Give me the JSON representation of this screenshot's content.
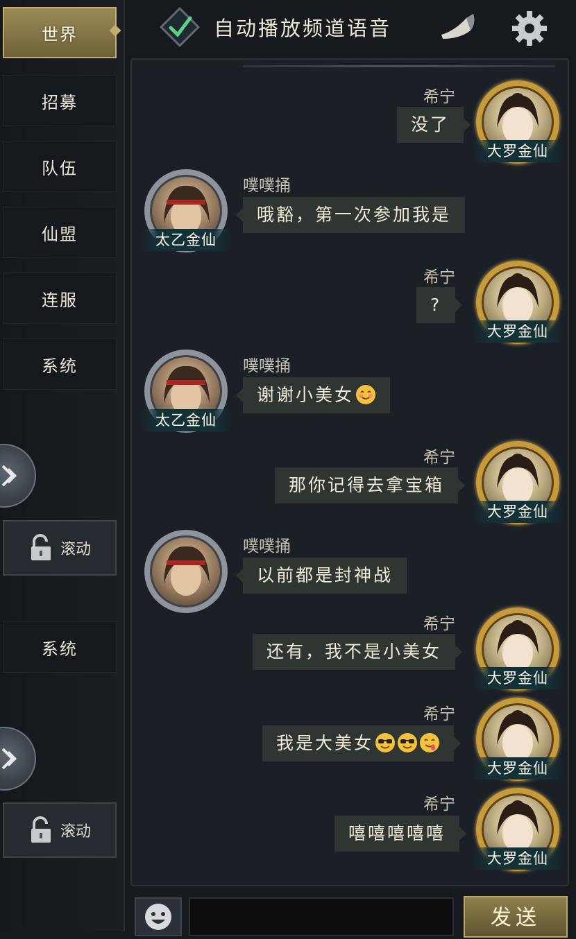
{
  "sidebar": {
    "tabs": [
      "世界",
      "招募",
      "队伍",
      "仙盟",
      "连服",
      "系统"
    ],
    "active_tab": "世界",
    "scroll_label": "滚动",
    "secondary_tab": "系统",
    "scroll_label_2": "滚动"
  },
  "header": {
    "auto_play_label": "自动播放频道语音",
    "auto_play_checked": true,
    "icons": [
      "check-icon",
      "horn-icon",
      "gear-icon"
    ]
  },
  "messages": [
    {
      "side": "right",
      "name": "希宁",
      "text": "没了",
      "title": "大罗金仙",
      "avatar": "female-avatar"
    },
    {
      "side": "left",
      "name": "噗噗捅",
      "text": "哦豁，第一次参加我是",
      "title": "太乙金仙",
      "avatar": "male-avatar"
    },
    {
      "side": "right",
      "name": "希宁",
      "text": "?",
      "title": "大罗金仙",
      "avatar": "female-avatar"
    },
    {
      "side": "left",
      "name": "噗噗捅",
      "text": "谢谢小美女",
      "emojis": [
        "blush-emoji"
      ],
      "title": "太乙金仙",
      "avatar": "male-avatar"
    },
    {
      "side": "right",
      "name": "希宁",
      "text": "那你记得去拿宝箱",
      "title": "大罗金仙",
      "avatar": "female-avatar"
    },
    {
      "side": "left",
      "name": "噗噗捅",
      "text": "以前都是封神战",
      "title": "",
      "avatar": "male-avatar"
    },
    {
      "side": "right",
      "name": "希宁",
      "text": "还有，我不是小美女",
      "title": "大罗金仙",
      "avatar": "female-avatar"
    },
    {
      "side": "right",
      "name": "希宁",
      "text": "我是大美女",
      "emojis": [
        "sunglasses-emoji",
        "sunglasses-emoji",
        "yum-emoji"
      ],
      "title": "大罗金仙",
      "avatar": "female-avatar"
    },
    {
      "side": "right",
      "name": "希宁",
      "text": "嘻嘻嘻嘻嘻",
      "title": "大罗金仙",
      "avatar": "female-avatar"
    }
  ],
  "bottom": {
    "send_label": "发送",
    "input_value": ""
  },
  "colors": {
    "gold_frame": "#c79a3a",
    "silver_frame": "#8d949b",
    "bubble": "#2f3530",
    "accent_gold": "#bda764"
  }
}
